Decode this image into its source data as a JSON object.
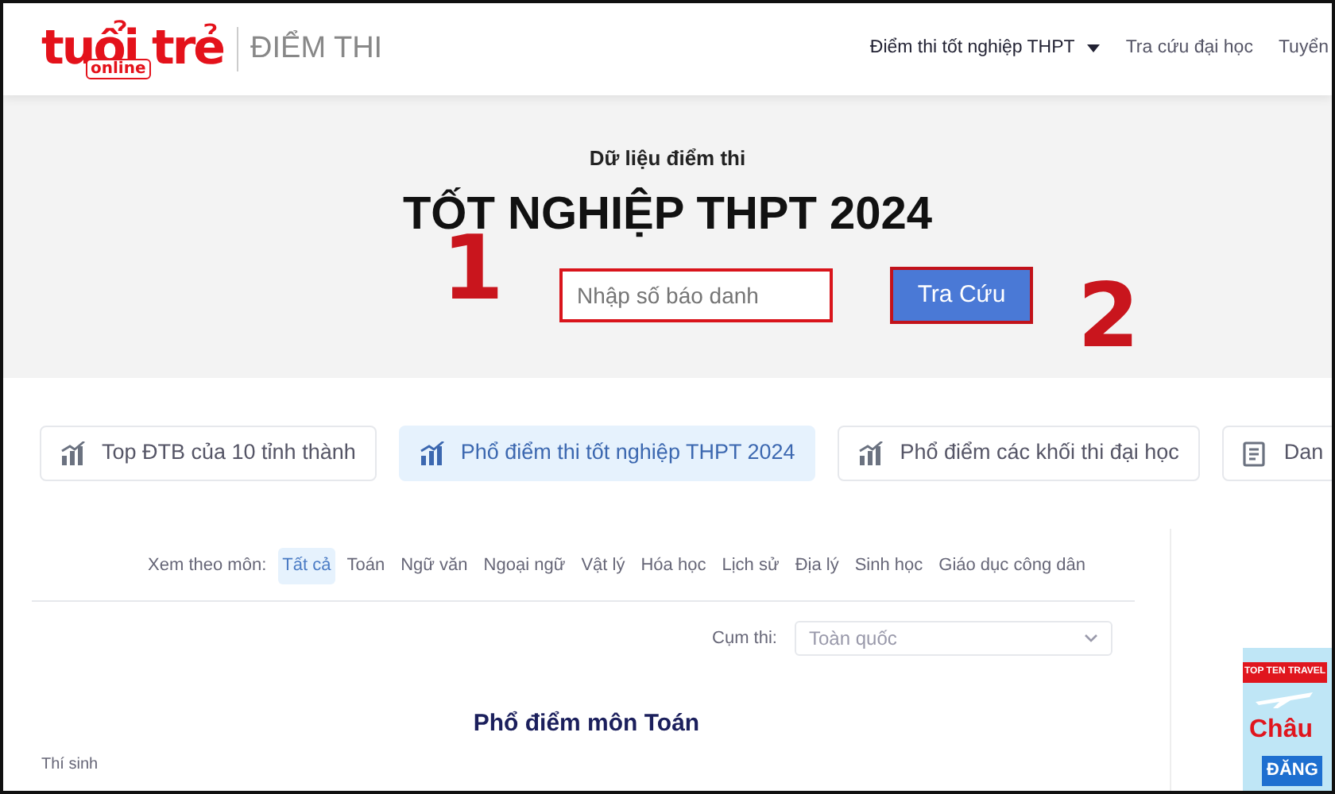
{
  "header": {
    "logo": {
      "word": "tuổi trẻ",
      "sub": "online"
    },
    "section": "ĐIỂM THI",
    "nav": [
      {
        "label": "Điểm thi tốt nghiệp THPT",
        "dropdown": true,
        "selected": true
      },
      {
        "label": "Tra cứu đại học",
        "dropdown": false,
        "selected": false
      },
      {
        "label": "Tuyển",
        "dropdown": false,
        "selected": false
      }
    ]
  },
  "hero": {
    "subtitle": "Dữ liệu điểm thi",
    "title": "TỐT NGHIỆP THPT 2024",
    "search": {
      "placeholder": "Nhập số báo danh"
    },
    "button": "Tra Cứu",
    "annotations": [
      {
        "label": "1"
      },
      {
        "label": "2"
      }
    ]
  },
  "tabs": [
    {
      "label": "Top ĐTB của 10 tỉnh thành",
      "kind": "chart",
      "selected": false
    },
    {
      "label": "Phổ điểm thi tốt nghiệp THPT 2024",
      "kind": "chart",
      "selected": true
    },
    {
      "label": "Phổ điểm các khối thi đại học",
      "kind": "chart",
      "selected": false
    },
    {
      "label": "Dan",
      "kind": "list",
      "selected": false
    }
  ],
  "subjects": {
    "label": "Xem theo môn:",
    "items": [
      {
        "label": "Tất cả",
        "selected": true
      },
      {
        "label": "Toán",
        "selected": false
      },
      {
        "label": "Ngữ văn",
        "selected": false
      },
      {
        "label": "Ngoại ngữ",
        "selected": false
      },
      {
        "label": "Vật lý",
        "selected": false
      },
      {
        "label": "Hóa học",
        "selected": false
      },
      {
        "label": "Lịch sử",
        "selected": false
      },
      {
        "label": "Địa lý",
        "selected": false
      },
      {
        "label": "Sinh học",
        "selected": false
      },
      {
        "label": "Giáo dục công dân",
        "selected": false
      }
    ]
  },
  "cluster": {
    "label": "Cụm thi:",
    "value": "Toàn quốc"
  },
  "chart": {
    "title": "Phổ điểm môn Toán",
    "ylabel": "Thí sinh"
  },
  "ad": {
    "brand": "TOP TEN TRAVEL",
    "headline": "Châu",
    "cta": "ĐĂNG"
  }
}
